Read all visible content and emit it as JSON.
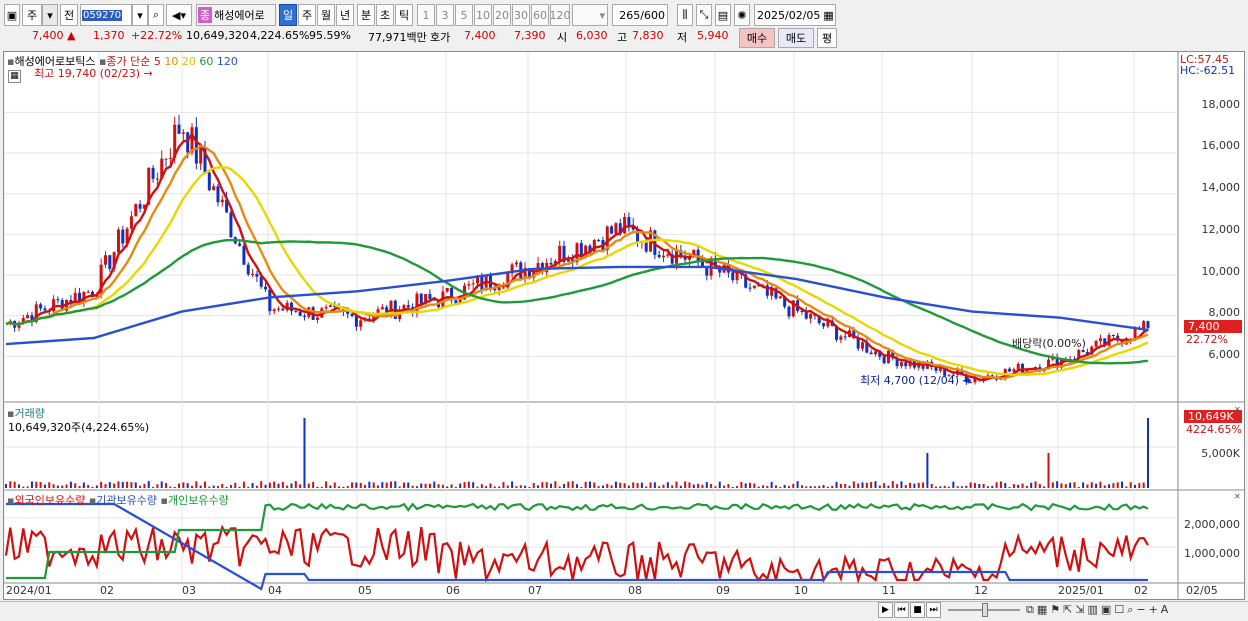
{
  "toolbar": {
    "period_type": "주",
    "compare": "전",
    "stock_code": "059270",
    "stock_name": "해성에어로",
    "badge_gray": "종",
    "periods": [
      "일",
      "주",
      "월",
      "년",
      "분",
      "초",
      "틱"
    ],
    "active_period": "일",
    "intervals": [
      "1",
      "3",
      "5",
      "10",
      "20",
      "30",
      "60",
      "120"
    ],
    "count_value": "265",
    "count_total": "/600",
    "date": "2025/02/05"
  },
  "quote": {
    "price": "7,400",
    "change_arrow": "▲",
    "change": "1,370",
    "change_rate": "+22.72%",
    "volume": "10,649,320",
    "volume_rate": "4,224.65%",
    "turnover_ratio": "95.59%",
    "amount": "77,971백만",
    "ask_label": "호가",
    "ask": "7,400",
    "bid": "7,390",
    "open_label": "시",
    "open": "6,030",
    "high_label": "고",
    "high": "7,830",
    "low_label": "저",
    "low": "5,940",
    "buy_label": "매수",
    "sell_label": "매도",
    "eval_label": "평"
  },
  "price_chart": {
    "legend_name": "해성에어로보틱스",
    "legend_ma_title": "종가 단순",
    "ma_periods": [
      "5",
      "10",
      "20",
      "60",
      "120"
    ],
    "ma_colors": [
      "#d01010",
      "#e88a10",
      "#e8d800",
      "#1f9a3a",
      "#2a4fd0"
    ],
    "high_note": "최고 19,740 (02/23)",
    "low_note": "최저 4,700 (12/04)",
    "dividend_note": "배당락(0.00%)",
    "lc": "LC:57.45",
    "hc": "HC:-62.51",
    "y_ticks": [
      "18,000",
      "16,000",
      "14,000",
      "12,000",
      "10,000",
      "8,000",
      "6,000"
    ],
    "last_price_tag": "7,400",
    "last_rate_tag": "22.72%"
  },
  "volume_chart": {
    "title": "거래량",
    "value_text": "10,649,320주(4,224.65%)",
    "tag_value": "10,649K",
    "tag_rate": "4224.65%",
    "y_tick": "5,000K"
  },
  "holding_chart": {
    "series": [
      "외국인보유수량",
      "기관보유수량",
      "개인보유수량"
    ],
    "series_colors": [
      "#d01010",
      "#2a4fd0",
      "#1f9a3a"
    ],
    "y_ticks": [
      "2,000,000",
      "1,000,000"
    ]
  },
  "x_axis": {
    "labels": [
      "2024/01",
      "02",
      "03",
      "04",
      "05",
      "06",
      "07",
      "08",
      "09",
      "10",
      "11",
      "12",
      "2025/01",
      "02"
    ],
    "right_label": "02/05"
  },
  "chart_data": {
    "type": "line",
    "title": "",
    "x": [
      "2024/01",
      "02",
      "03",
      "04",
      "05",
      "06",
      "07",
      "08",
      "09",
      "10",
      "11",
      "12",
      "2025/01",
      "02"
    ],
    "series": [
      {
        "name": "종가",
        "values": [
          7600,
          9300,
          17500,
          8400,
          7900,
          8900,
          10500,
          12300,
          10400,
          8200,
          6000,
          4900,
          5800,
          7400
        ]
      },
      {
        "name": "120",
        "values": [
          6600,
          6900,
          8200,
          8900,
          9200,
          9700,
          10300,
          10400,
          10400,
          9800,
          8900,
          8200,
          7900,
          7300
        ]
      }
    ],
    "ylim": [
      4000,
      19740
    ]
  }
}
